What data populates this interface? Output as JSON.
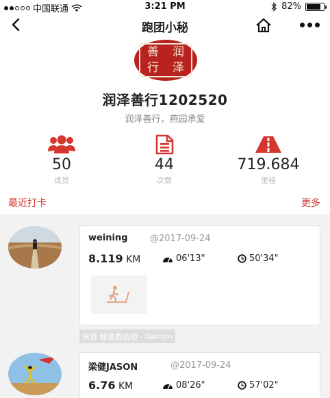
{
  "status_bar": {
    "carrier": "中国联通",
    "time": "3:21 PM",
    "battery": "82%",
    "battery_level": 0.82
  },
  "nav": {
    "title": "跑团小秘"
  },
  "club": {
    "logo_chars": [
      "善",
      "润",
      "行",
      "泽"
    ],
    "name": "润泽善行1202520",
    "motto": "润泽善行，燕园承爱"
  },
  "stats": [
    {
      "icon": "members-icon",
      "value": "50",
      "label": "成员"
    },
    {
      "icon": "records-icon",
      "value": "44",
      "label": "次数"
    },
    {
      "icon": "road-icon",
      "value": "719.684",
      "label": "里程"
    }
  ],
  "section": {
    "title": "最近打卡",
    "more": "更多"
  },
  "feed": [
    {
      "user": "weining",
      "date": "@2017-09-24",
      "distance": "8.119",
      "unit": "KM",
      "pace": "06'13\"",
      "duration": "50'34\"",
      "source": "来自 郁金香运动 - Garmin"
    },
    {
      "user": "梁健JASON",
      "date": "@2017-09-24",
      "distance": "6.76",
      "unit": "KM",
      "pace": "08'26\"",
      "duration": "57'02\""
    }
  ],
  "colors": {
    "accent": "#d5362f",
    "logo": "#b8231f"
  }
}
